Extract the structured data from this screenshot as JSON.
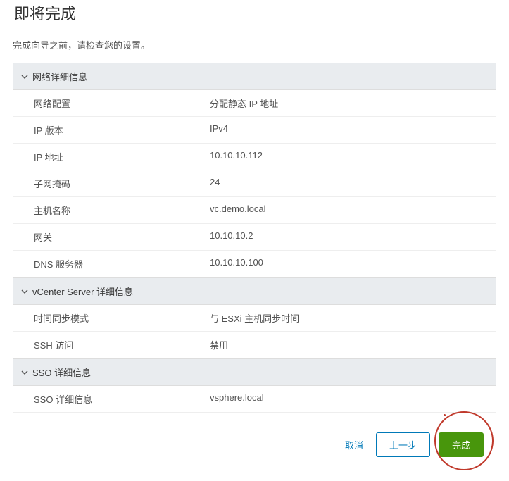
{
  "title": "即将完成",
  "subtitle": "完成向导之前，请检查您的设置。",
  "sections": [
    {
      "header": "网络详细信息",
      "rows": [
        {
          "label": "网络配置",
          "value": "分配静态 IP 地址"
        },
        {
          "label": "IP 版本",
          "value": "IPv4"
        },
        {
          "label": "IP 地址",
          "value": "10.10.10.112"
        },
        {
          "label": "子网掩码",
          "value": "24"
        },
        {
          "label": "主机名称",
          "value": "vc.demo.local"
        },
        {
          "label": "网关",
          "value": "10.10.10.2"
        },
        {
          "label": "DNS 服务器",
          "value": "10.10.10.100"
        }
      ]
    },
    {
      "header": "vCenter Server 详细信息",
      "rows": [
        {
          "label": "时间同步模式",
          "value": "与 ESXi 主机同步时间"
        },
        {
          "label": "SSH 访问",
          "value": "禁用"
        }
      ]
    },
    {
      "header": "SSO 详细信息",
      "rows": [
        {
          "label": "SSO 详细信息",
          "value": "vsphere.local"
        }
      ]
    }
  ],
  "footer": {
    "cancel": "取消",
    "back": "上一步",
    "finish": "完成"
  }
}
